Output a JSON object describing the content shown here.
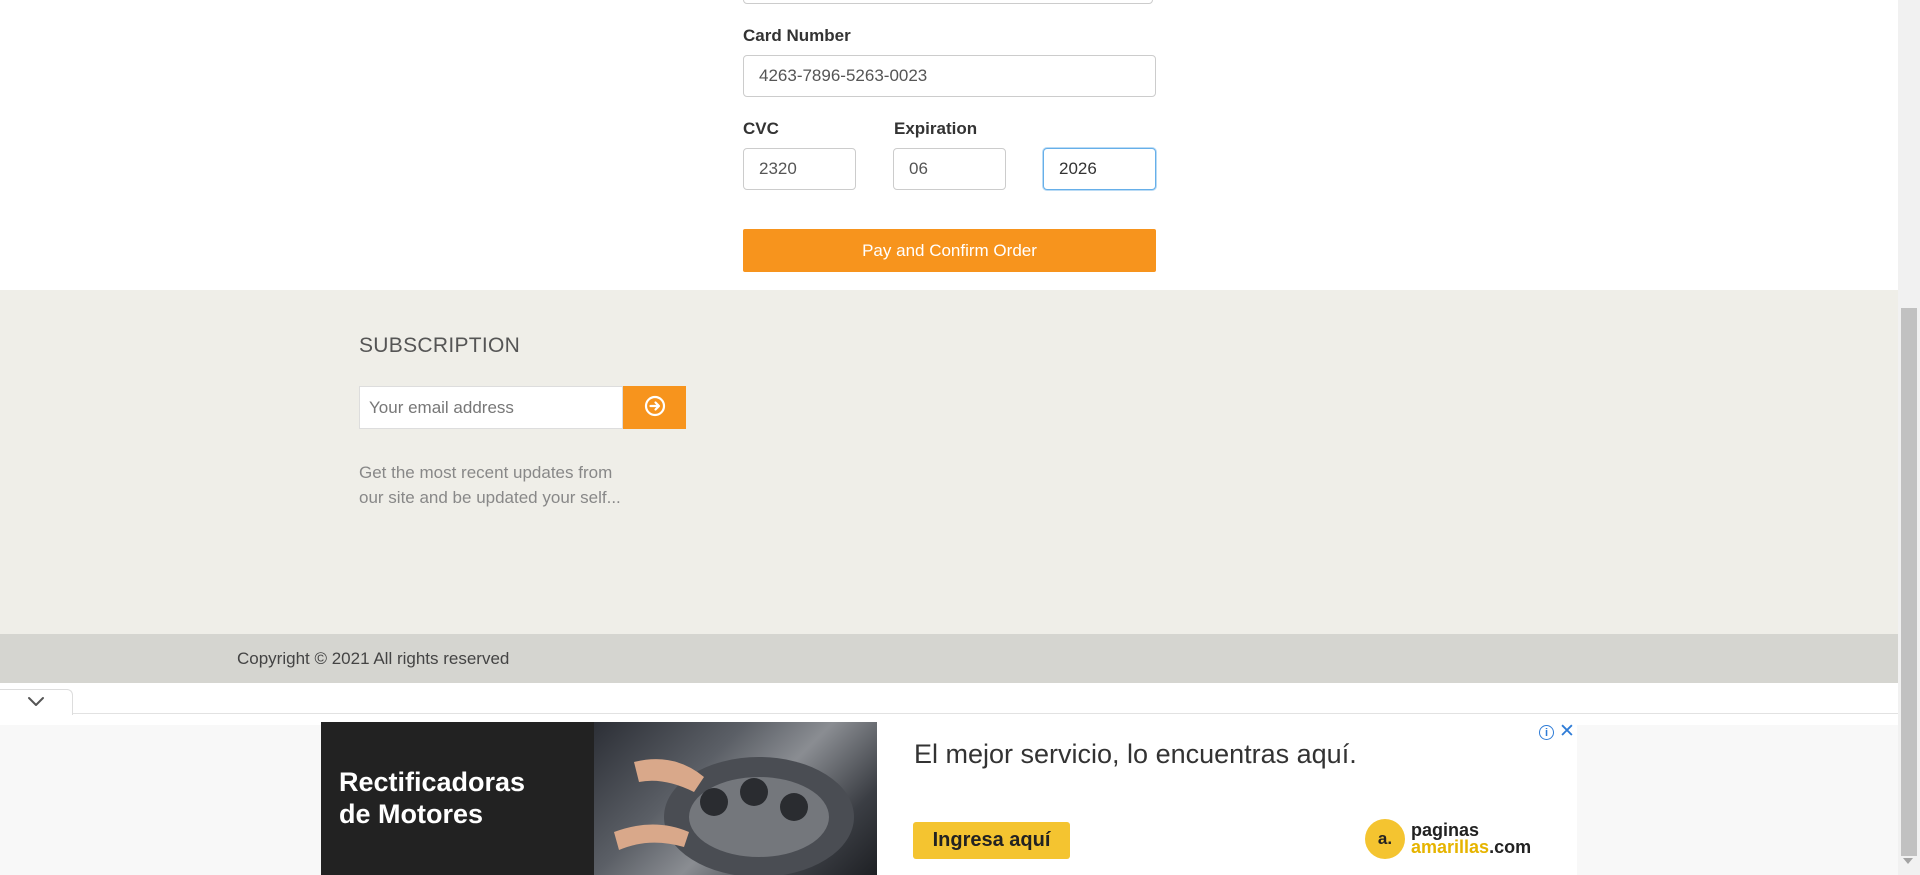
{
  "checkout": {
    "card_number_label": "Card Number",
    "card_number_value": "4263-7896-5263-0023",
    "cvc_label": "CVC",
    "cvc_value": "2320",
    "expiration_label": "Expiration",
    "exp_month_value": "06",
    "exp_year_value": "2026",
    "pay_button_label": "Pay and Confirm Order"
  },
  "footer": {
    "subscription_title": "SUBSCRIPTION",
    "email_placeholder": "Your email address",
    "subscribe_icon": "circle-arrow-right-icon",
    "description_line1": "Get the most recent updates from",
    "description_line2": "our site and be updated your self...",
    "copyright": "Copyright © 2021 All rights reserved"
  },
  "ad": {
    "left_text": "Rectificadoras\nde Motores",
    "headline": "El mejor servicio, lo encuentras aquí.",
    "cta_label": "Ingresa aquí",
    "brand_logo": "a.",
    "brand_line1": "paginas",
    "brand_line2": "amarillas",
    "brand_suffix": ".com",
    "info_icon": "ⓘ",
    "close_icon": "✕",
    "collapse_icon": "chevron-down-icon"
  },
  "colors": {
    "accent": "#f7941d",
    "footer_bg": "#efeee8",
    "footer_bottom_bg": "#d5d5d0",
    "ad_cta": "#f4c430"
  }
}
